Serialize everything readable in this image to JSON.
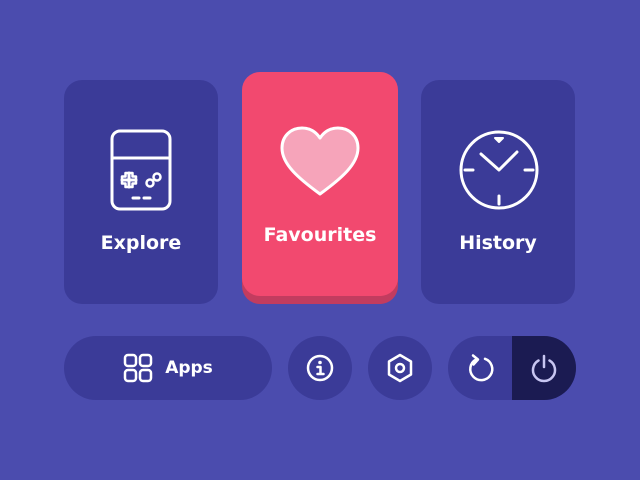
{
  "cards": {
    "explore": {
      "label": "Explore",
      "icon": "handheld-console-icon"
    },
    "favourites": {
      "label": "Favourites",
      "icon": "heart-icon"
    },
    "history": {
      "label": "History",
      "icon": "clock-icon"
    }
  },
  "bottom_bar": {
    "apps": {
      "label": "Apps",
      "icon": "apps-grid-icon"
    },
    "info": {
      "icon": "info-icon"
    },
    "settings": {
      "icon": "hexagon-nut-settings-icon"
    },
    "reload": {
      "icon": "reload-icon"
    },
    "power": {
      "icon": "power-icon"
    }
  },
  "colors": {
    "background": "#4b4cae",
    "card": "#3b3b98",
    "selected_card": "#f2496f",
    "power_bg": "#1b1b52",
    "heart_fill": "#f6a4ba"
  }
}
